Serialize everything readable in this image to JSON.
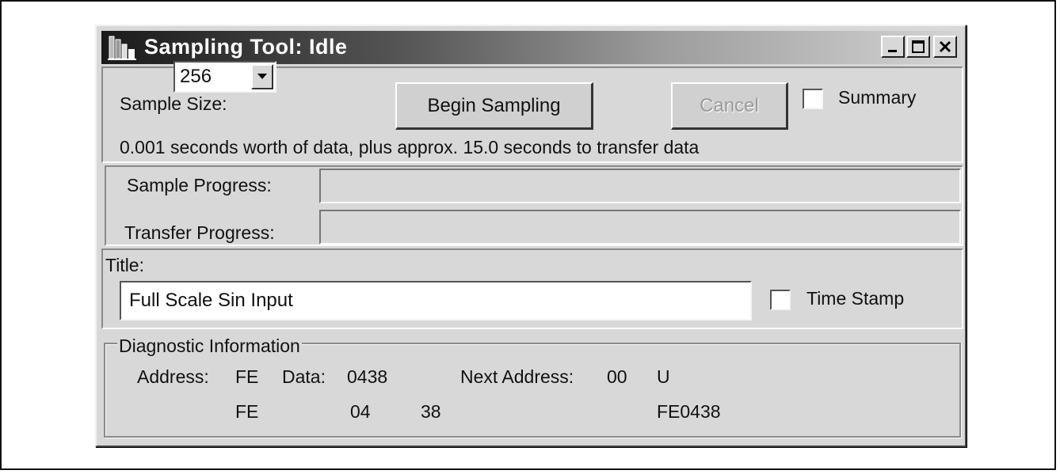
{
  "window": {
    "title": "Sampling Tool: Idle",
    "controls": {
      "minimize": "_",
      "maximize": "□",
      "close": "×"
    }
  },
  "sampling": {
    "size_label": "Sample Size:",
    "size_value": "256",
    "begin_label": "Begin Sampling",
    "cancel_label": "Cancel",
    "summary_label": "Summary",
    "summary_checked": false,
    "info_text": "0.001 seconds worth of data, plus approx. 15.0 seconds to transfer data"
  },
  "progress": {
    "sample_label": "Sample Progress:",
    "sample_value": 0,
    "transfer_label": "Transfer Progress:",
    "transfer_value": 0
  },
  "title_section": {
    "label": "Title:",
    "value": "Full Scale Sin Input",
    "timestamp_label": "Time Stamp",
    "timestamp_checked": false
  },
  "diagnostic": {
    "legend": "Diagnostic Information",
    "address_label": "Address:",
    "address_value": "FE",
    "data_label": "Data:",
    "data_value": "0438",
    "next_address_label": "Next Address:",
    "next_address_value": "00",
    "flag": "U",
    "row2": {
      "address": "FE",
      "data_hi": "04",
      "data_lo": "38",
      "combined": "FE0438"
    }
  },
  "colors": {
    "face": "#d8d8d8",
    "titlebar_dark": "#1a1a1a",
    "titlebar_light": "#d4d4d4"
  }
}
